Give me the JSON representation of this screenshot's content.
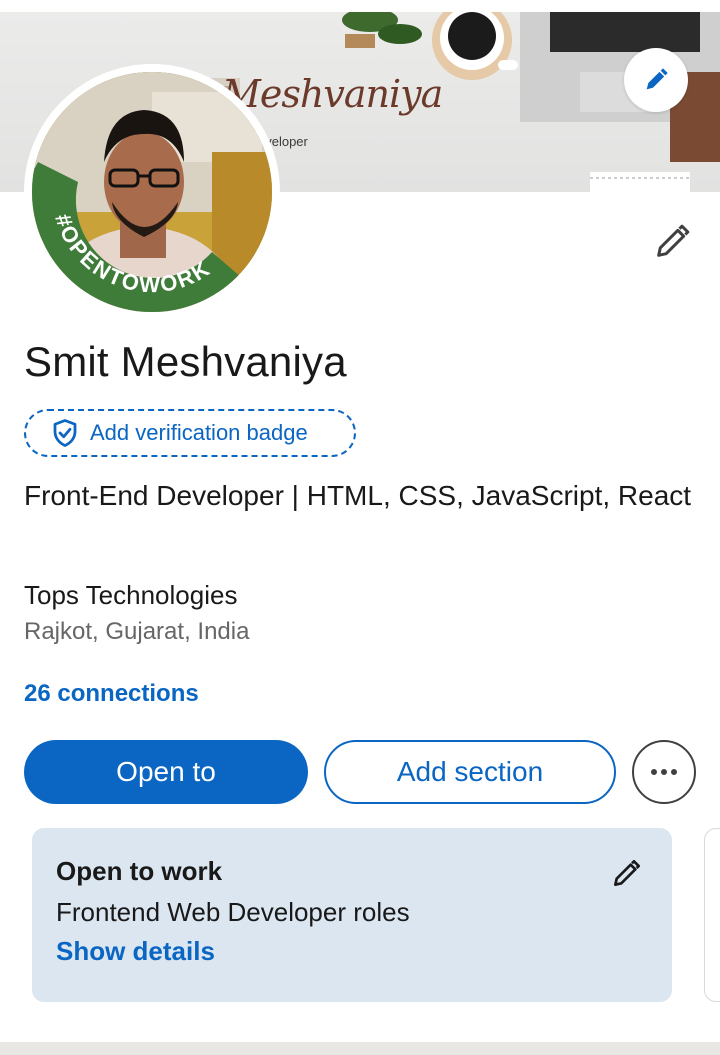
{
  "profile": {
    "name": "Smit Meshvaniya",
    "verification_badge_label": "Add verification badge",
    "headline": "Front-End Developer | HTML, CSS, JavaScript, React",
    "company": "Tops Technologies",
    "location": "Rajkot, Gujarat, India",
    "connections": "26 connections",
    "avatar_frame_text": "#OPENTOWORK"
  },
  "cover": {
    "signature_text": "Meshvaniya",
    "subtitle_text": "eveloper"
  },
  "actions": {
    "open_to_label": "Open to",
    "add_section_label": "Add section"
  },
  "open_to_work": {
    "title": "Open to work",
    "roles": "Frontend Web Developer roles",
    "show_details_label": "Show details"
  },
  "icons": {
    "cover_edit": "pencil-icon",
    "profile_edit": "pencil-icon",
    "badge": "shield-check-icon",
    "more": "more-horizontal-icon",
    "card_edit": "pencil-icon"
  },
  "colors": {
    "brand": "#0a66c2",
    "open_to_work_green": "#3f7c3a",
    "card_bg": "#dce6f1"
  }
}
